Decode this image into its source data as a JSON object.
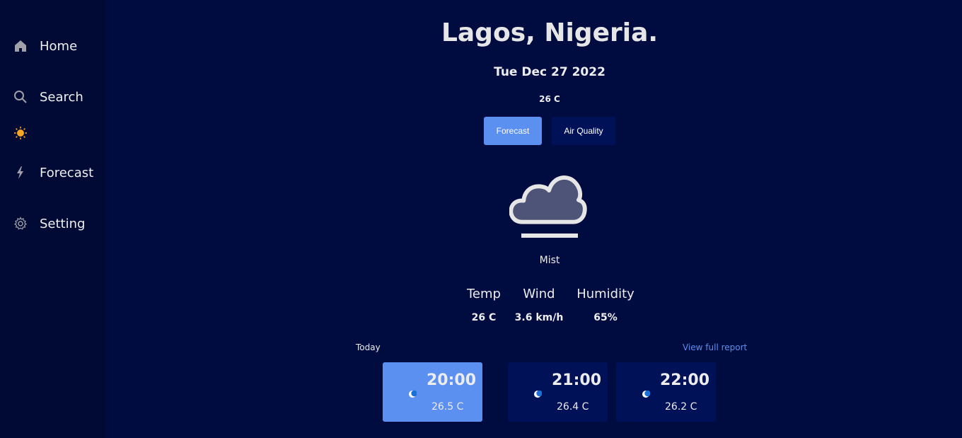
{
  "sidebar": {
    "items": [
      {
        "label": "Home",
        "icon": "home-icon"
      },
      {
        "label": "Search",
        "icon": "search-icon"
      },
      {
        "label": "",
        "icon": "sun-icon"
      },
      {
        "label": "Forecast",
        "icon": "lightning-icon"
      },
      {
        "label": "Setting",
        "icon": "gear-icon"
      }
    ]
  },
  "header": {
    "city": "Lagos, Nigeria.",
    "date": "Tue Dec 27 2022",
    "temp": "26 C"
  },
  "tabs": {
    "forecast": "Forecast",
    "air_quality": "Air Quality"
  },
  "current": {
    "icon": "cloud-mist-icon",
    "condition": "Mist",
    "stats": [
      {
        "label": "Temp",
        "value": "26 C"
      },
      {
        "label": "Wind",
        "value": "3.6 km/h"
      },
      {
        "label": "Humidity",
        "value": "65%"
      }
    ]
  },
  "hourly": {
    "title": "Today",
    "view_report": "View full report",
    "items": [
      {
        "time": "20:00",
        "temp": "26.5 C",
        "icon": "moon-icon"
      },
      {
        "time": "21:00",
        "temp": "26.4 C",
        "icon": "moon-icon"
      },
      {
        "time": "22:00",
        "temp": "26.2 C",
        "icon": "moon-icon"
      }
    ]
  },
  "colors": {
    "background": "#000c40",
    "sidebar": "#000a35",
    "accent": "#5b8ff0",
    "card": "#011158"
  }
}
